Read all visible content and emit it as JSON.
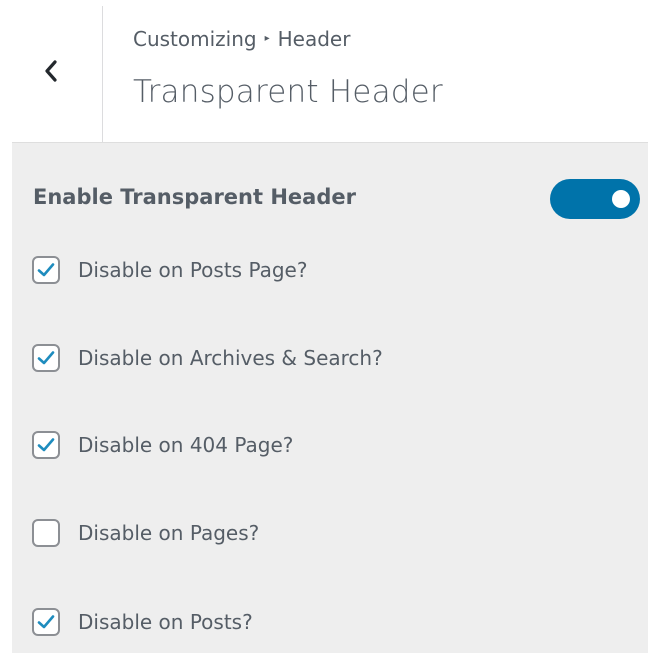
{
  "header": {
    "back_icon": "chevron-left-icon",
    "breadcrumb": {
      "root": "Customizing",
      "separator": "▸",
      "current": "Header"
    },
    "title": "Transparent Header"
  },
  "panel": {
    "toggle": {
      "label": "Enable Transparent Header",
      "enabled": true,
      "color": "#0073aa"
    },
    "options": [
      {
        "label": "Disable on Posts Page?",
        "checked": true
      },
      {
        "label": "Disable on Archives & Search?",
        "checked": true
      },
      {
        "label": "Disable on 404 Page?",
        "checked": true
      },
      {
        "label": "Disable on Pages?",
        "checked": false
      },
      {
        "label": "Disable on Posts?",
        "checked": true
      }
    ]
  }
}
